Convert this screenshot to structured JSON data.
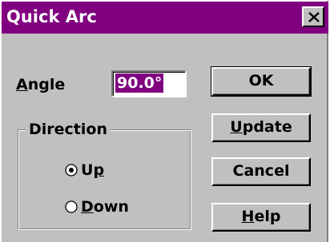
{
  "window": {
    "title": "Quick Arc",
    "close_symbol": "×"
  },
  "angle": {
    "label_mnemonic": "A",
    "label_rest": "ngle",
    "value": "90.0°"
  },
  "direction": {
    "group_label": "Direction",
    "options": [
      {
        "label_pre": "U",
        "label_mnemonic": "p",
        "label_post": "",
        "selected": true
      },
      {
        "label_pre": "",
        "label_mnemonic": "D",
        "label_post": "own",
        "selected": false
      }
    ]
  },
  "buttons": {
    "ok": {
      "pre": "OK",
      "mnemonic": "",
      "post": ""
    },
    "update": {
      "pre": "",
      "mnemonic": "U",
      "post": "pdate"
    },
    "cancel": {
      "pre": "Cancel",
      "mnemonic": "",
      "post": ""
    },
    "help": {
      "pre": "",
      "mnemonic": "H",
      "post": "elp"
    }
  },
  "colors": {
    "titlebar": "#800080",
    "face": "#c0c0c0",
    "selection": "#800080"
  },
  "icons": {
    "close": "close-icon",
    "radio_selected": "radio-selected-icon",
    "radio_unselected": "radio-unselected-icon"
  }
}
